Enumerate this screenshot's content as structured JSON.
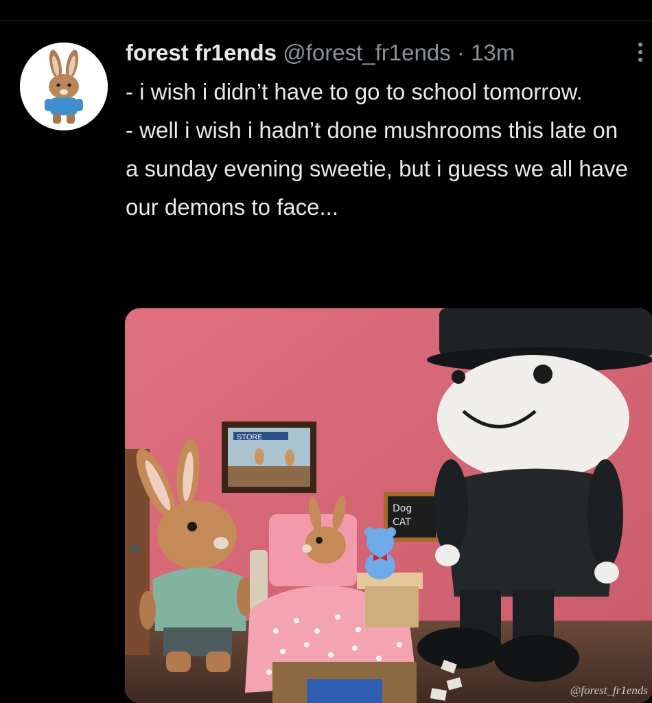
{
  "tweet": {
    "display_name": "forest fr1ends",
    "handle": "@forest_fr1ends",
    "separator": "·",
    "time": "13m",
    "text_lines": [
      "- i wish i didn’t have to go to school tomorrow.",
      "- well i wish i hadn’t done mushrooms this late on a sunday evening sweetie, but i guess we all have our demons to face..."
    ],
    "more_icon": "more-vertical-icon"
  },
  "media": {
    "picture_text": {
      "frame_sign": "STORE",
      "chalkboard_line1": "Dog",
      "chalkboard_line2": "CAT"
    },
    "watermark": "@forest_fr1ends"
  },
  "colors": {
    "background": "#000000",
    "text_primary": "#e7e9ea",
    "text_secondary": "#8b9197",
    "divider": "#2f3336"
  }
}
